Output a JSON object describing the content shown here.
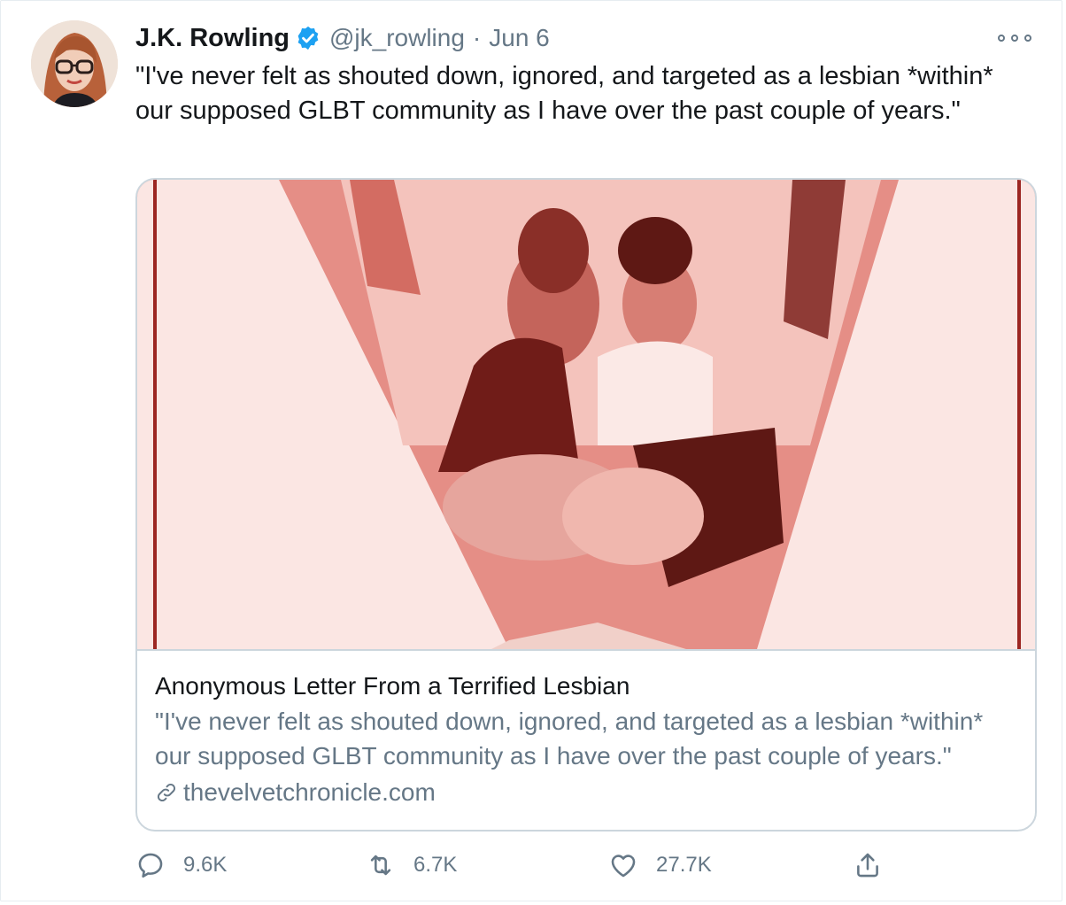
{
  "author": {
    "name": "J.K. Rowling",
    "handle": "@jk_rowling",
    "separator": "·",
    "date": "Jun 6",
    "verified_color": "#1da1f2"
  },
  "tweet": {
    "text": "\"I've never felt as shouted down, ignored, and targeted as a lesbian *within* our supposed GLBT community as I have over the past couple of years.\""
  },
  "card": {
    "title": "Anonymous Letter From a Terrified Lesbian",
    "description": "\"I've never felt as shouted down, ignored, and targeted as a lesbian *within* our supposed GLBT community as I have over the past couple of years.\"",
    "domain": "thevelvetchronicle.com",
    "image_tint": "#d9574f"
  },
  "actions": {
    "reply": {
      "icon": "reply-icon",
      "count": "9.6K"
    },
    "retweet": {
      "icon": "retweet-icon",
      "count": "6.7K"
    },
    "like": {
      "icon": "heart-icon",
      "count": "27.7K"
    },
    "share": {
      "icon": "share-icon"
    }
  },
  "colors": {
    "text": "#14171a",
    "secondary": "#657786",
    "border": "#ccd6dd"
  }
}
